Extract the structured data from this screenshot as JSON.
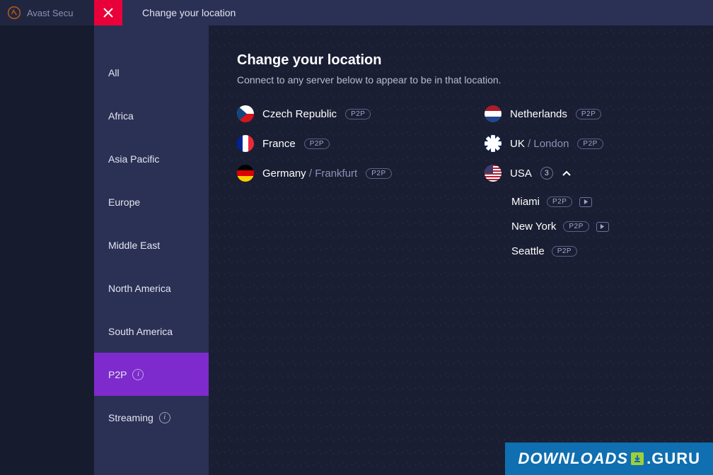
{
  "app": {
    "title": "Avast Secu"
  },
  "header": {
    "title": "Change your location"
  },
  "sidebar": {
    "items": [
      {
        "label": "All",
        "hasInfo": false,
        "active": false
      },
      {
        "label": "Africa",
        "hasInfo": false,
        "active": false
      },
      {
        "label": "Asia Pacific",
        "hasInfo": false,
        "active": false
      },
      {
        "label": "Europe",
        "hasInfo": false,
        "active": false
      },
      {
        "label": "Middle East",
        "hasInfo": false,
        "active": false
      },
      {
        "label": "North America",
        "hasInfo": false,
        "active": false
      },
      {
        "label": "South America",
        "hasInfo": false,
        "active": false
      },
      {
        "label": "P2P",
        "hasInfo": true,
        "active": true
      },
      {
        "label": "Streaming",
        "hasInfo": true,
        "active": false
      }
    ]
  },
  "page": {
    "title": "Change your location",
    "subtitle": "Connect to any server below to appear to be in that location."
  },
  "badges": {
    "p2p": "P2P"
  },
  "locations": {
    "left": [
      {
        "name": "Czech Republic",
        "city": "",
        "flag": "cz",
        "p2p": true
      },
      {
        "name": "France",
        "city": "",
        "flag": "fr",
        "p2p": true
      },
      {
        "name": "Germany",
        "city": "Frankfurt",
        "flag": "de",
        "p2p": true
      }
    ],
    "right": [
      {
        "name": "Netherlands",
        "city": "",
        "flag": "nl",
        "p2p": true
      },
      {
        "name": "UK",
        "city": "London",
        "flag": "uk",
        "p2p": true
      }
    ],
    "usa": {
      "name": "USA",
      "count": "3",
      "expanded": true,
      "cities": [
        {
          "name": "Miami",
          "p2p": true,
          "streaming": true
        },
        {
          "name": "New York",
          "p2p": true,
          "streaming": true
        },
        {
          "name": "Seattle",
          "p2p": true,
          "streaming": false
        }
      ]
    }
  },
  "watermark": {
    "left": "DOWNLOADS",
    "right": ".GURU"
  }
}
